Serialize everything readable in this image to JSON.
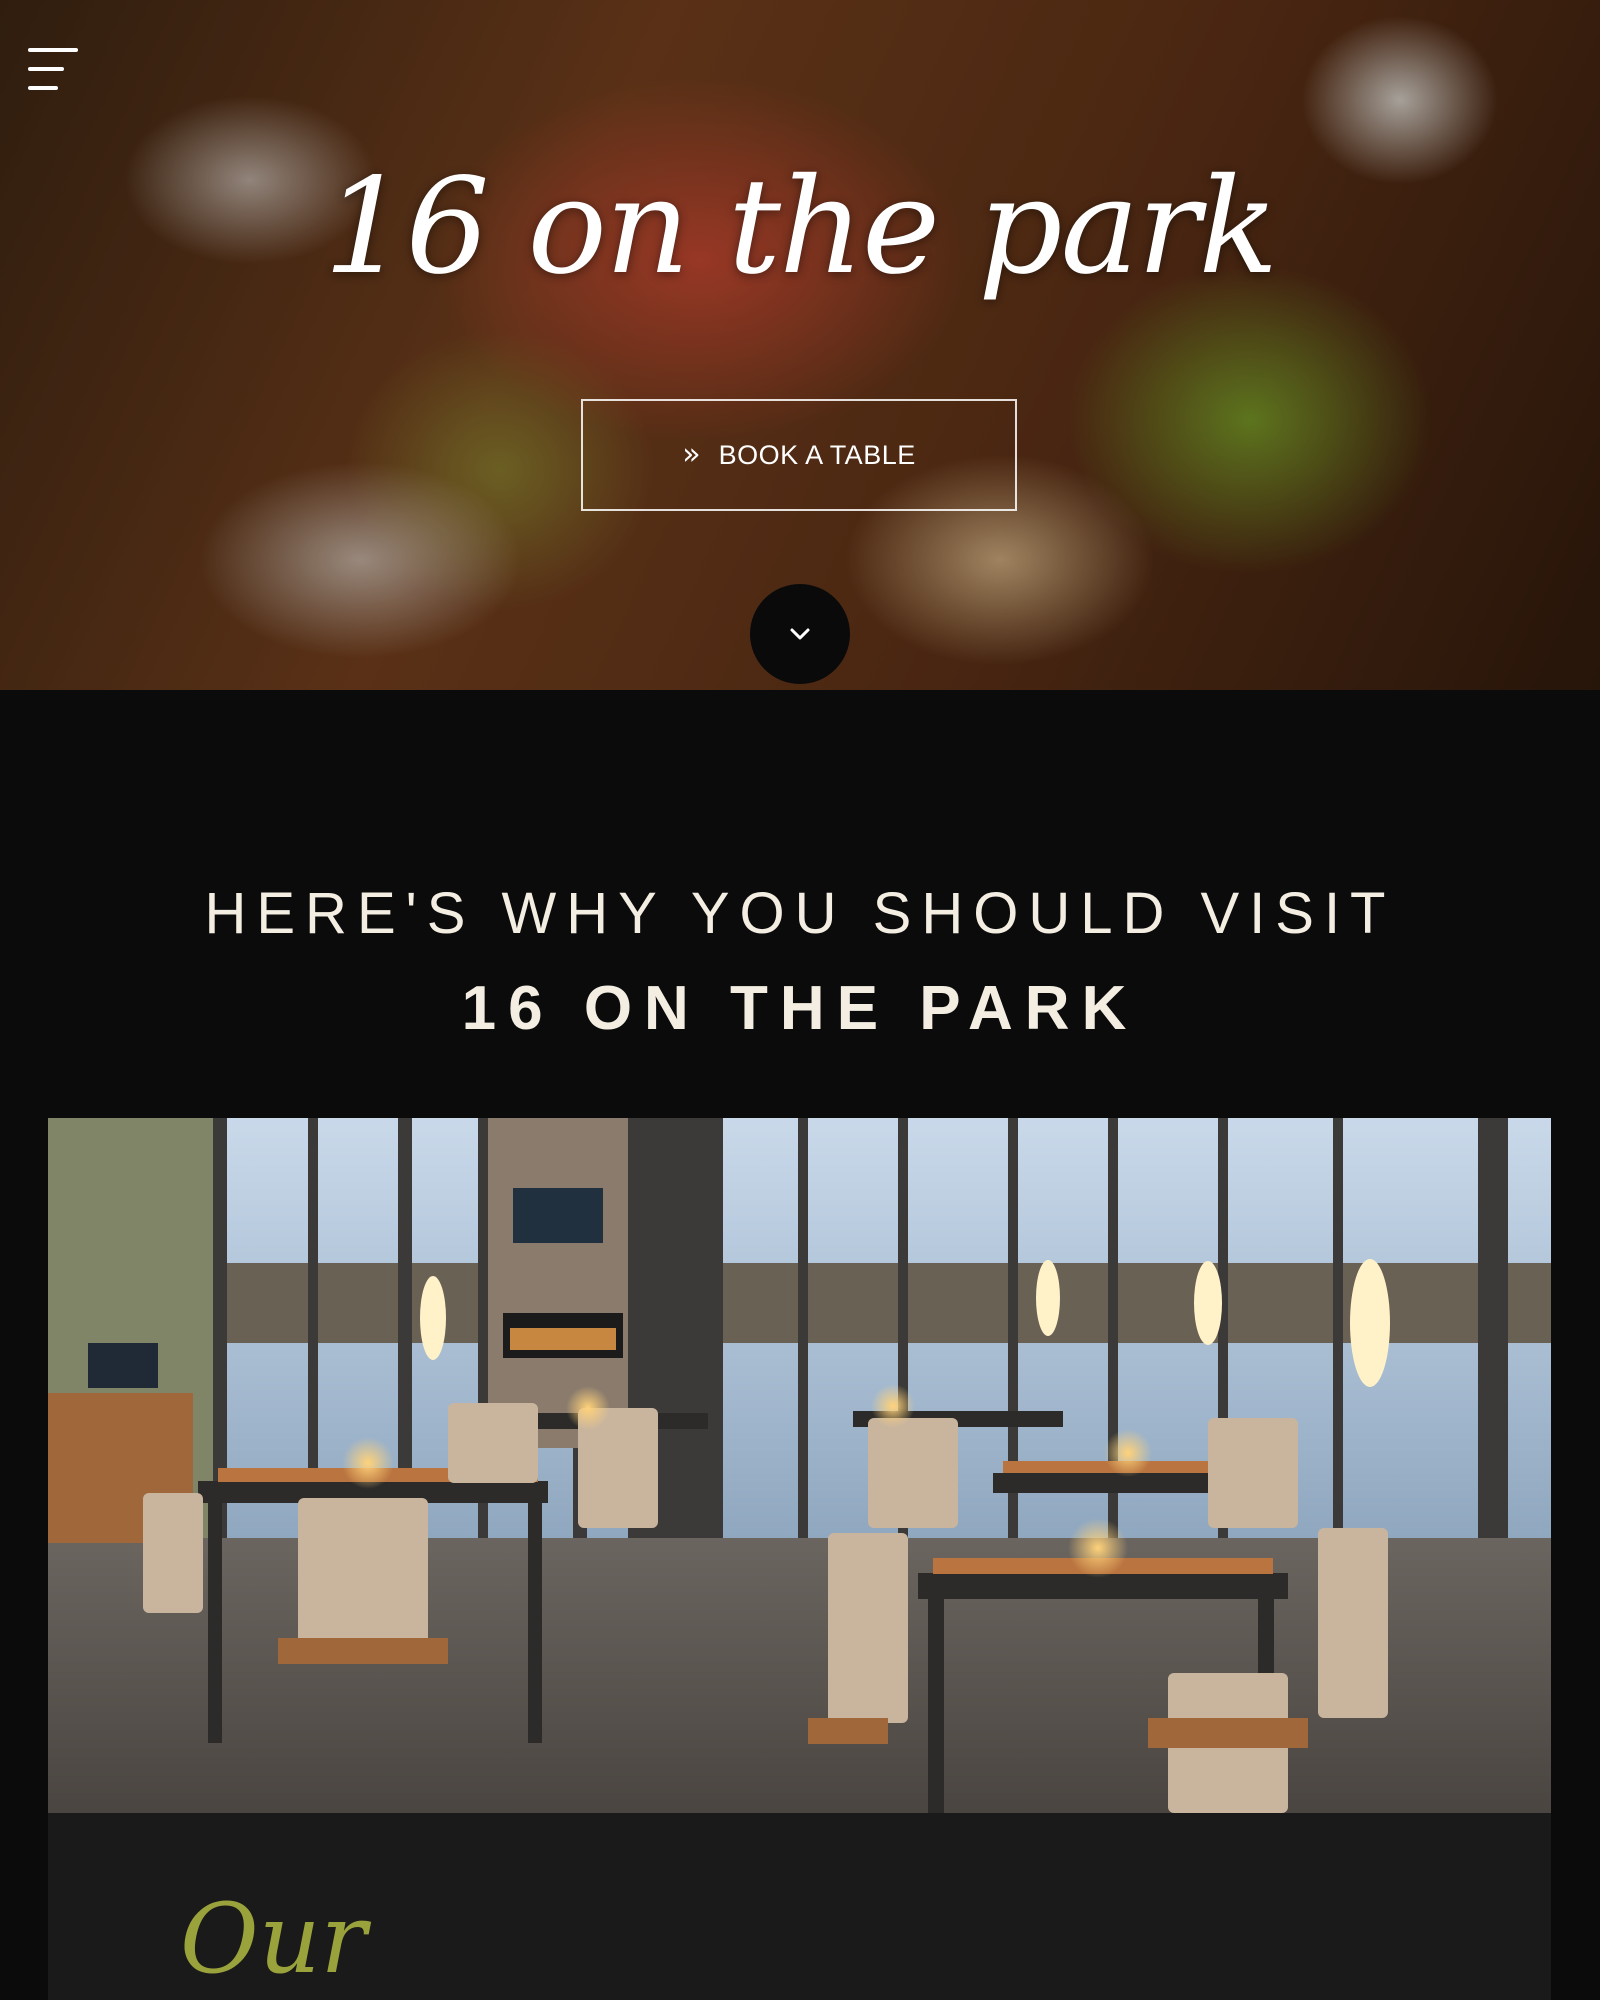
{
  "hero": {
    "logo_text": "16 on the park",
    "book_label": "BOOK A TABLE",
    "chevrons": "»"
  },
  "intro": {
    "line1": "HERE'S WHY YOU SHOULD VISIT",
    "line2": "16 ON THE PARK"
  },
  "panel": {
    "script_heading": "Our"
  },
  "colors": {
    "page_background": "#0b0b0c",
    "panel_background": "#1a1a1a",
    "text_cream": "#f3ede2",
    "accent_olive": "#9aa23c"
  },
  "icons": {
    "menu": "hamburger-icon",
    "scroll": "chevron-down-icon",
    "book": "double-chevron-right-icon"
  }
}
